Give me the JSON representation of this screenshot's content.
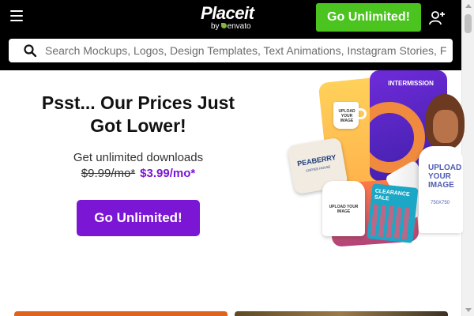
{
  "header": {
    "logo_main": "Placeit",
    "logo_by": "by",
    "logo_brand": "envato",
    "cta_label": "Go Unlimited!"
  },
  "search": {
    "placeholder": "Search Mockups, Logos, Design Templates, Text Animations, Instagram Stories, F"
  },
  "hero": {
    "title": "Psst... Our Prices Just Got Lower!",
    "subtitle": "Get unlimited downloads",
    "old_price": "$9.99/mo*",
    "new_price": "$3.99/mo*",
    "cta_label": "Go Unlimited!"
  },
  "collage": {
    "intermission": "INTERMISSION",
    "mug_text": "UPLOAD YOUR IMAGE",
    "sticker_title": "PEABERRY",
    "sticker_sub": "COFFEE HOUSE",
    "hoodie_text": "UPLOAD YOUR IMAGE",
    "clearance_text": "CLEARANCE SALE",
    "shirt_text": "UPLOAD YOUR IMAGE",
    "shirt_size": "750X750"
  },
  "colors": {
    "header_bg": "#000000",
    "top_cta": "#4bc41f",
    "hero_cta": "#7b16d4",
    "new_price": "#7b16d4"
  }
}
